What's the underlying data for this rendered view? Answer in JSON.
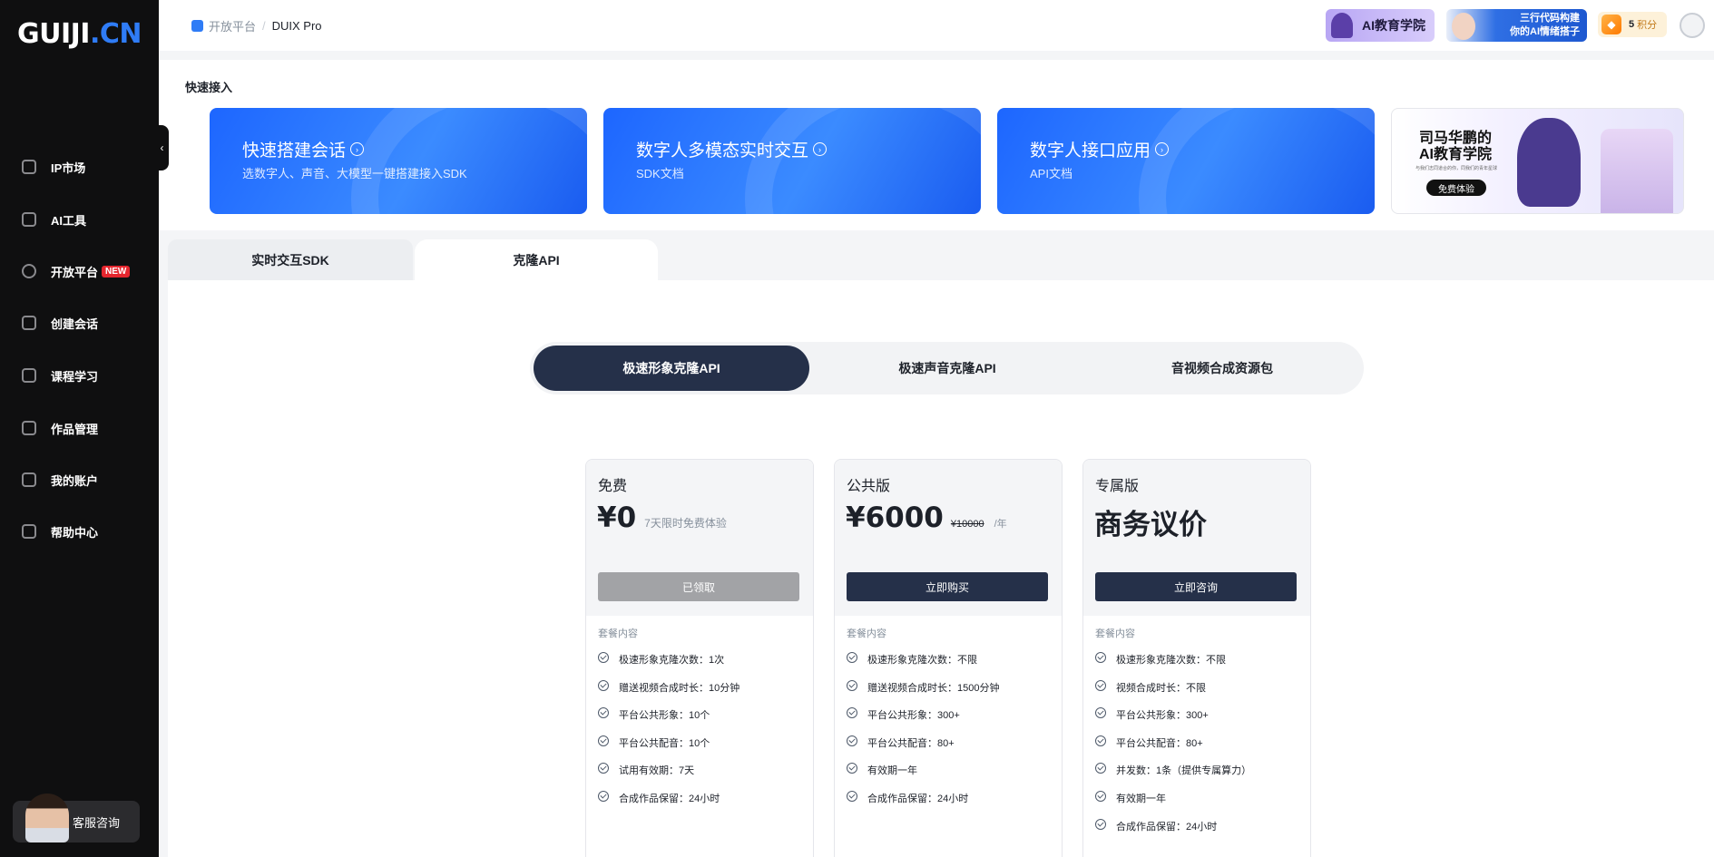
{
  "brand": {
    "logo_main": "GUIJI",
    "logo_suffix": ".CN"
  },
  "sidebar": {
    "items": [
      {
        "label": "IP市场",
        "icon": "store-icon"
      },
      {
        "label": "AI工具",
        "icon": "tool-icon"
      },
      {
        "label": "开放平台",
        "icon": "rocket-icon",
        "badge": "NEW"
      },
      {
        "label": "创建会话",
        "icon": "chat-icon"
      },
      {
        "label": "课程学习",
        "icon": "course-icon"
      },
      {
        "label": "作品管理",
        "icon": "works-icon"
      },
      {
        "label": "我的账户",
        "icon": "account-icon"
      },
      {
        "label": "帮助中心",
        "icon": "help-icon"
      }
    ],
    "service_label": "客服咨询"
  },
  "header": {
    "breadcrumb": [
      "开放平台",
      "/",
      "DUIX Pro"
    ],
    "ad1": "AI教育学院",
    "ad2_line1": "三行代码构建",
    "ad2_line2": "你的AI情绪搭子",
    "points_value": "5",
    "points_unit": "积分"
  },
  "quick_access": {
    "title": "快速接入",
    "cards": [
      {
        "title": "快速搭建会话",
        "subtitle": "选数字人、声音、大模型一键搭建接入SDK"
      },
      {
        "title": "数字人多模态实时交互",
        "subtitle": "SDK文档"
      },
      {
        "title": "数字人接口应用",
        "subtitle": "API文档"
      }
    ],
    "promo": {
      "title_line1": "司马华鹏的",
      "title_line2": "AI教育学院",
      "small": "与我们志同道合的你，同我们的青年星球",
      "button": "免费体验"
    }
  },
  "tabs": [
    "实时交互SDK",
    "克隆API"
  ],
  "segments": [
    "极速形象克隆API",
    "极速声音克隆API",
    "音视频合成资源包"
  ],
  "plans": [
    {
      "name": "免费",
      "price": "¥0",
      "note": "7天限时免费体验",
      "button": "已领取",
      "features_label": "套餐内容",
      "features": [
        "极速形象克隆次数：1次",
        "赠送视频合成时长：10分钟",
        "平台公共形象：10个",
        "平台公共配音：10个",
        "试用有效期：7天",
        "合成作品保留：24小时"
      ]
    },
    {
      "name": "公共版",
      "price": "¥6000",
      "old_price": "¥10000",
      "per": "/年",
      "button": "立即购买",
      "features_label": "套餐内容",
      "features": [
        "极速形象克隆次数：不限",
        "赠送视频合成时长：1500分钟",
        "平台公共形象：300+",
        "平台公共配音：80+",
        "有效期一年",
        "合成作品保留：24小时"
      ]
    },
    {
      "name": "专属版",
      "price": "商务议价",
      "button": "立即咨询",
      "features_label": "套餐内容",
      "features": [
        "极速形象克隆次数：不限",
        "视频合成时长：不限",
        "平台公共形象：300+",
        "平台公共配音：80+",
        "并发数：1条（提供专属算力）",
        "有效期一年",
        "合成作品保留：24小时"
      ]
    }
  ],
  "colors": {
    "accent": "#2f7cf6",
    "dark_button": "#253049",
    "sidebar_bg": "#0f0f10",
    "new_badge": "#e5262e"
  }
}
